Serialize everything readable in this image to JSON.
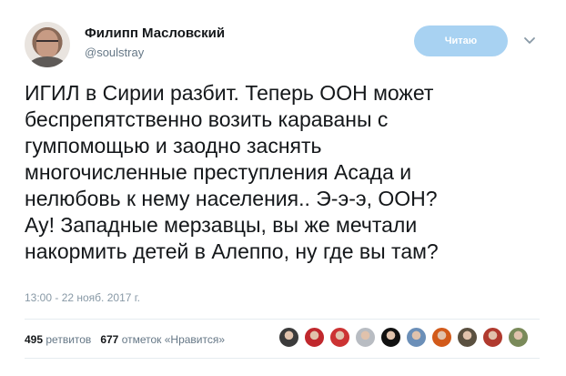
{
  "user": {
    "name": "Филипп Масловский",
    "handle": "@soulstray"
  },
  "follow_button": {
    "label": "Читаю"
  },
  "tweet": {
    "text": "ИГИЛ в Сирии разбит. Теперь ООН может\nбеспрепятственно возить караваны с\nгумпомощью и заодно заснять\nмногочисленные преступления Асада и\nнелюбовь к нему населения.. Э-э-э, ООН?\nАу! Западные мерзавцы, вы же мечтали\nнакормить детей в Алеппо, ну где вы там?",
    "timestamp": "13:00 - 22 нояб. 2017 г."
  },
  "stats": {
    "retweets_count": "495",
    "retweets_label": "ретвитов",
    "likes_count": "677",
    "likes_label": "отметок «Нравится»"
  },
  "likers": [
    {
      "icon": "avatar-1",
      "color": "#3b3b3b"
    },
    {
      "icon": "avatar-2",
      "color": "#c0282d"
    },
    {
      "icon": "avatar-3",
      "color": "#cc3333"
    },
    {
      "icon": "avatar-4",
      "color": "#b8bcc2"
    },
    {
      "icon": "avatar-5",
      "color": "#111111"
    },
    {
      "icon": "avatar-6",
      "color": "#6b8fb8"
    },
    {
      "icon": "avatar-7",
      "color": "#d25a1a"
    },
    {
      "icon": "avatar-8",
      "color": "#5a5040"
    },
    {
      "icon": "avatar-9",
      "color": "#b03a2e"
    },
    {
      "icon": "avatar-10",
      "color": "#7a8a5a"
    }
  ],
  "colors": {
    "accent": "#1da1f2",
    "follow_button_bg": "#a8d2f2",
    "muted_text": "#657786"
  }
}
